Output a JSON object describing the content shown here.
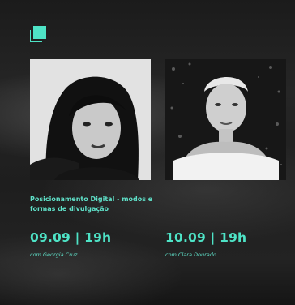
{
  "colors": {
    "accent": "#4ee3c6",
    "background": "#1e1e1e"
  },
  "logo": {
    "icon": "square-bracket-logo-icon"
  },
  "event": {
    "title": "Posicionamento Digital - modos e formas de divulgação"
  },
  "sessions": [
    {
      "date_time": "09.09 | 19h",
      "host": "com Georgia Cruz"
    },
    {
      "date_time": "10.09 | 19h",
      "host": "com Clara Dourado"
    }
  ]
}
